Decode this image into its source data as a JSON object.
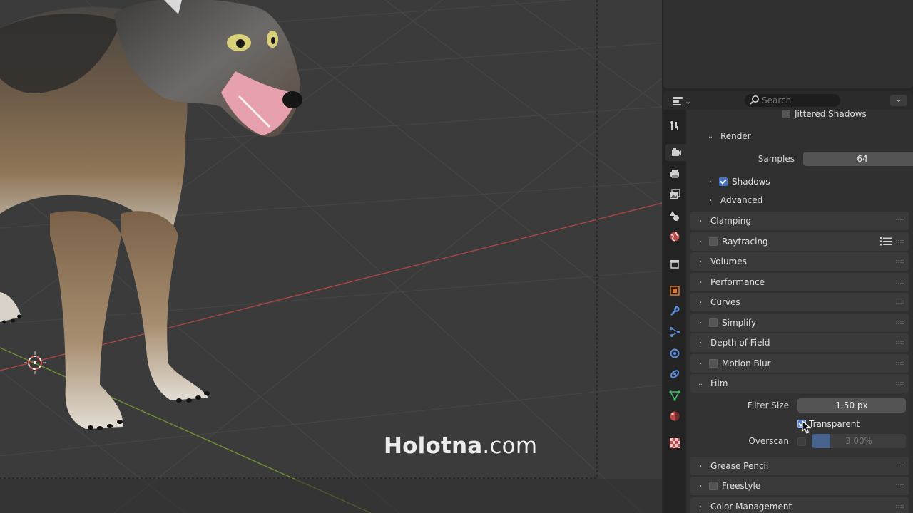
{
  "watermark": {
    "brand": "Holotna",
    "domain": ".com"
  },
  "header": {
    "search_placeholder": "Search",
    "editor_type_icon": "properties-editor-icon"
  },
  "tabs": [
    {
      "name": "tool",
      "icon": "wrench-screwdriver-icon"
    },
    {
      "name": "render",
      "icon": "camera-back-icon",
      "active": true
    },
    {
      "name": "output",
      "icon": "printer-icon"
    },
    {
      "name": "view-layer",
      "icon": "image-stack-icon"
    },
    {
      "name": "scene",
      "icon": "scene-cone-sphere-icon"
    },
    {
      "name": "world",
      "icon": "world-globe-icon"
    },
    {
      "name": "collection",
      "icon": "collection-box-icon"
    },
    {
      "name": "object",
      "icon": "object-square-icon"
    },
    {
      "name": "modifiers",
      "icon": "wrench-icon"
    },
    {
      "name": "particles",
      "icon": "particles-icon"
    },
    {
      "name": "physics",
      "icon": "physics-orbit-icon"
    },
    {
      "name": "constraints",
      "icon": "constraint-icon"
    },
    {
      "name": "data",
      "icon": "mesh-data-triangle-icon"
    },
    {
      "name": "material",
      "icon": "material-sphere-icon"
    },
    {
      "name": "texture",
      "icon": "texture-checker-icon"
    }
  ],
  "panels": {
    "jittered_shadows": "Jittered Shadows",
    "render": {
      "label": "Render",
      "samples_label": "Samples",
      "samples_value": "64",
      "shadows_label": "Shadows",
      "advanced_label": "Advanced"
    },
    "clamping": "Clamping",
    "raytracing": "Raytracing",
    "volumes": "Volumes",
    "performance": "Performance",
    "curves": "Curves",
    "simplify": "Simplify",
    "depth_of_field": "Depth of Field",
    "motion_blur": "Motion Blur",
    "film": {
      "label": "Film",
      "filter_size_label": "Filter Size",
      "filter_size_value": "1.50 px",
      "transparent_label": "Transparent",
      "overscan_label": "Overscan",
      "overscan_value": "3.00%",
      "overscan_fill": 0.2
    },
    "grease_pencil": "Grease Pencil",
    "freestyle": "Freestyle",
    "color_management": "Color Management"
  },
  "colors": {
    "accent": "#4773c6",
    "x_axis": "#b04a4a",
    "y_axis": "#7a9a3a"
  }
}
